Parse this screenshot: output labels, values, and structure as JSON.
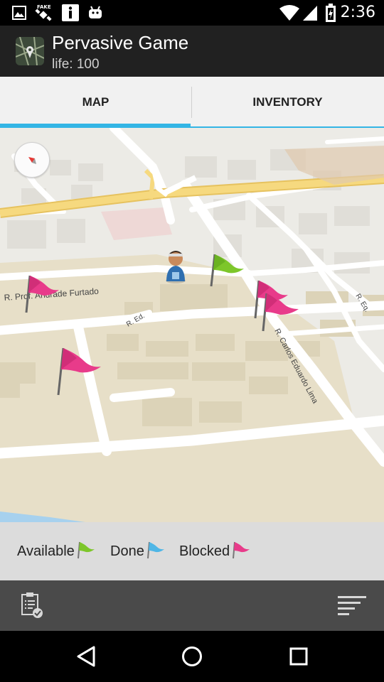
{
  "status_bar": {
    "time": "2:36",
    "icons": [
      "image-icon",
      "fake-gps-icon",
      "info-icon",
      "android-icon",
      "wifi-icon",
      "signal-icon",
      "battery-icon"
    ]
  },
  "app_bar": {
    "title": "Pervasive Game",
    "subtitle": "life: 100",
    "icon": "map-app-icon"
  },
  "tabs": [
    {
      "label": "MAP",
      "selected": true
    },
    {
      "label": "INVENTORY",
      "selected": false
    }
  ],
  "map": {
    "street_labels": [
      "R. Prof. Andrade Furtado",
      "R. Carlos Eduardo Lima",
      "R. Eq.",
      "R. Ed."
    ],
    "flags": [
      {
        "status": "available",
        "color": "#7dc62a"
      },
      {
        "status": "blocked",
        "color": "#e83b8a"
      },
      {
        "status": "blocked",
        "color": "#e83b8a"
      },
      {
        "status": "blocked",
        "color": "#e83b8a"
      },
      {
        "status": "blocked",
        "color": "#e83b8a"
      }
    ],
    "player_icon": "player-avatar-icon",
    "compass_icon": "compass-icon"
  },
  "legend": [
    {
      "label": "Available",
      "color": "#7dc62a",
      "icon": "green-flag-icon"
    },
    {
      "label": "Done",
      "color": "#4fb6e6",
      "icon": "blue-flag-icon"
    },
    {
      "label": "Blocked",
      "color": "#e83b8a",
      "icon": "pink-flag-icon"
    }
  ],
  "bottom_bar": {
    "left_icon": "quest-list-icon",
    "right_icon": "sort-menu-icon"
  },
  "nav_bar": {
    "icons": [
      "back-icon",
      "home-icon",
      "recents-icon"
    ]
  },
  "colors": {
    "accent": "#33b5e5",
    "action_bar": "#212121",
    "map_park": "#e7dfc8",
    "map_highway": "#f4d070"
  }
}
